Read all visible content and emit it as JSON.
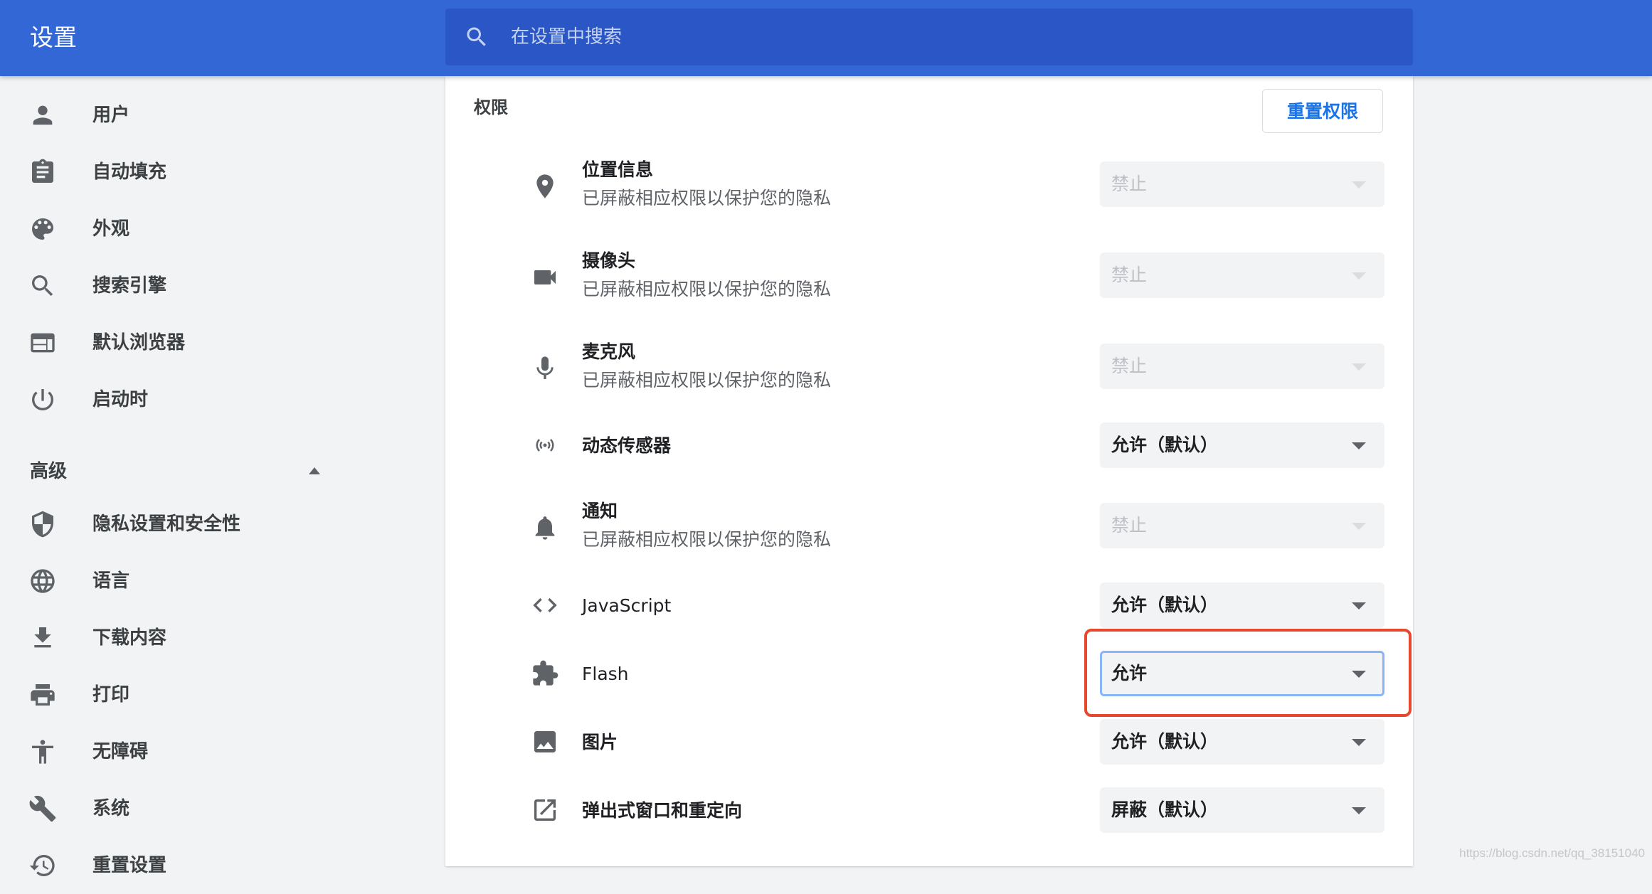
{
  "header": {
    "title": "设置",
    "search_placeholder": "在设置中搜索"
  },
  "sidebar": {
    "items": [
      {
        "label": "用户",
        "icon": "person-icon"
      },
      {
        "label": "自动填充",
        "icon": "clipboard-icon"
      },
      {
        "label": "外观",
        "icon": "palette-icon"
      },
      {
        "label": "搜索引擎",
        "icon": "search-icon"
      },
      {
        "label": "默认浏览器",
        "icon": "browser-window-icon"
      },
      {
        "label": "启动时",
        "icon": "power-icon"
      }
    ],
    "advanced_label": "高级",
    "advanced_items": [
      {
        "label": "隐私设置和安全性",
        "icon": "shield-icon"
      },
      {
        "label": "语言",
        "icon": "globe-icon"
      },
      {
        "label": "下载内容",
        "icon": "download-icon"
      },
      {
        "label": "打印",
        "icon": "printer-icon"
      },
      {
        "label": "无障碍",
        "icon": "accessibility-icon"
      },
      {
        "label": "系统",
        "icon": "wrench-icon"
      },
      {
        "label": "重置设置",
        "icon": "restore-icon"
      }
    ]
  },
  "permissions": {
    "section_title": "权限",
    "reset_button": "重置权限",
    "rows": [
      {
        "title": "位置信息",
        "subtitle": "已屏蔽相应权限以保护您的隐私",
        "value": "禁止",
        "disabled": true,
        "icon": "location-pin-icon"
      },
      {
        "title": "摄像头",
        "subtitle": "已屏蔽相应权限以保护您的隐私",
        "value": "禁止",
        "disabled": true,
        "icon": "camera-icon"
      },
      {
        "title": "麦克风",
        "subtitle": "已屏蔽相应权限以保护您的隐私",
        "value": "禁止",
        "disabled": true,
        "icon": "microphone-icon"
      },
      {
        "title": "动态传感器",
        "value": "允许（默认）",
        "disabled": false,
        "icon": "sensor-icon"
      },
      {
        "title": "通知",
        "subtitle": "已屏蔽相应权限以保护您的隐私",
        "value": "禁止",
        "disabled": true,
        "icon": "bell-icon"
      },
      {
        "title": "JavaScript",
        "value": "允许（默认）",
        "disabled": false,
        "icon": "code-icon"
      },
      {
        "title": "Flash",
        "value": "允许",
        "disabled": false,
        "focused": true,
        "icon": "puzzle-icon"
      },
      {
        "title": "图片",
        "value": "允许（默认）",
        "disabled": false,
        "icon": "image-icon"
      },
      {
        "title": "弹出式窗口和重定向",
        "value": "屏蔽（默认）",
        "disabled": false,
        "icon": "open-external-icon"
      }
    ]
  },
  "colors": {
    "header_bg": "#3367d6",
    "search_bg": "#2a56c6",
    "accent": "#1a73e8",
    "highlight": "#e8472e"
  },
  "watermark": "https://blog.csdn.net/qq_38151040"
}
